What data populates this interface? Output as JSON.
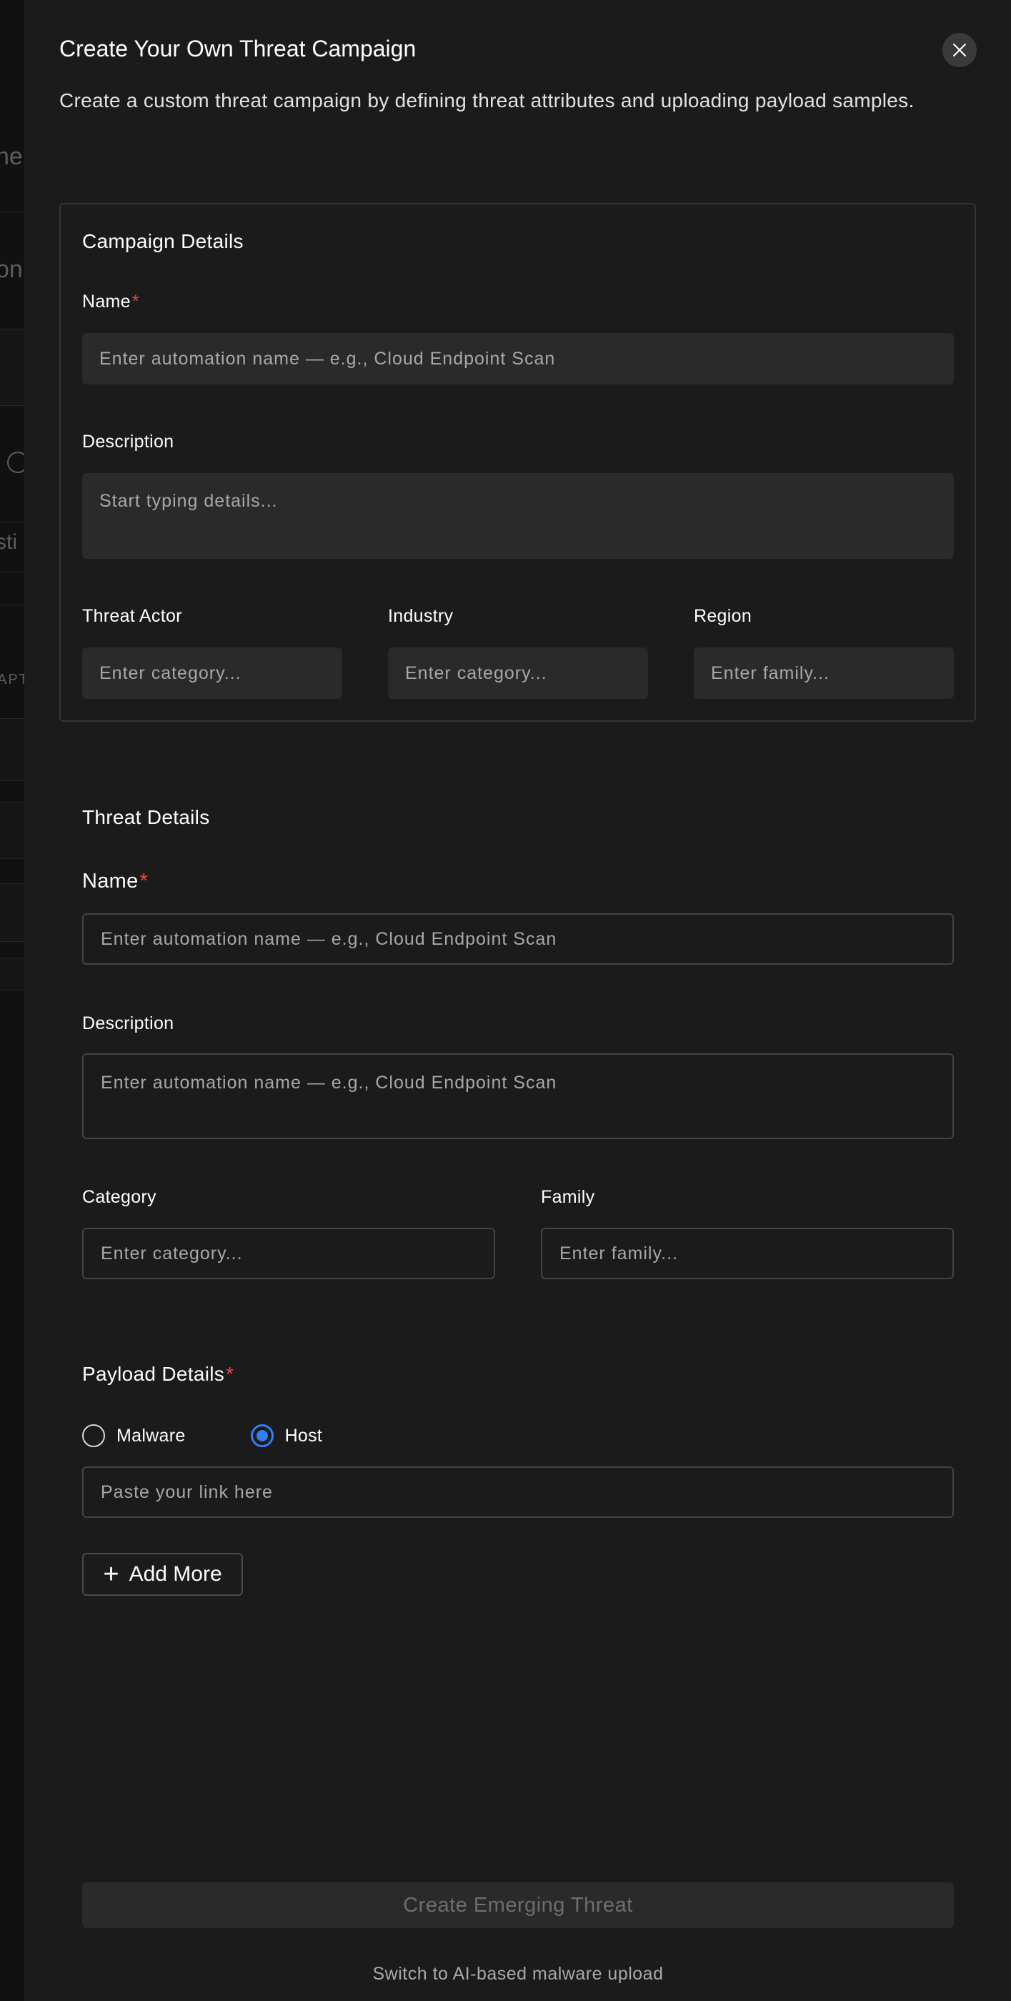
{
  "background": {
    "fragments": [
      "he",
      "on",
      "sti",
      "APT"
    ]
  },
  "modal": {
    "title": "Create Your Own Threat Campaign",
    "subtitle": "Create a custom threat campaign by defining threat attributes and uploading payload samples.",
    "close_icon": "close-icon"
  },
  "campaign": {
    "title": "Campaign Details",
    "name_label": "Name",
    "name_placeholder": "Enter automation name — e.g., Cloud Endpoint Scan",
    "description_label": "Description",
    "description_placeholder": "Start typing details...",
    "threat_actor_label": "Threat Actor",
    "threat_actor_placeholder": "Enter category...",
    "industry_label": "Industry",
    "industry_placeholder": "Enter category...",
    "region_label": "Region",
    "region_placeholder": "Enter family..."
  },
  "threat": {
    "title": "Threat Details",
    "name_label": "Name",
    "name_placeholder": "Enter automation name — e.g., Cloud Endpoint Scan",
    "description_label": "Description",
    "description_placeholder": "Enter automation name — e.g., Cloud Endpoint Scan",
    "category_label": "Category",
    "category_placeholder": "Enter category...",
    "family_label": "Family",
    "family_placeholder": "Enter family..."
  },
  "payload": {
    "title": "Payload Details",
    "options": [
      "Malware",
      "Host"
    ],
    "selected": "Host",
    "link_placeholder": "Paste your link here",
    "add_more_label": "Add More",
    "add_icon": "plus-icon"
  },
  "footer": {
    "create_label": "Create Emerging Threat",
    "switch_label": "Switch to AI-based malware upload"
  },
  "colors": {
    "panel_bg": "#1b1b1b",
    "input_bg": "#2a2a2a",
    "required": "#e5484d",
    "accent": "#2f7ff6"
  }
}
